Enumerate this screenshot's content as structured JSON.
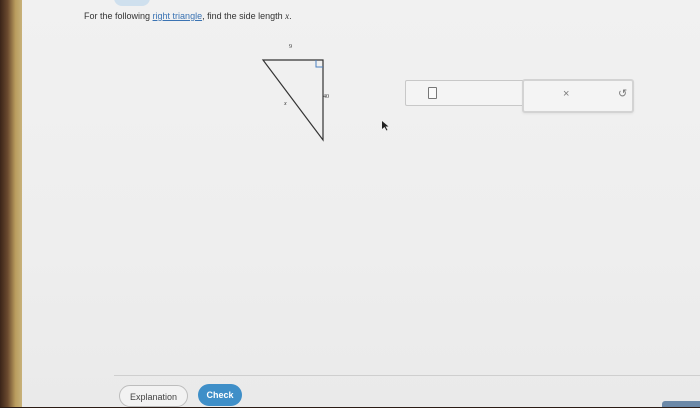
{
  "question": {
    "prefix": "For the following ",
    "link_text": "right triangle",
    "suffix": ", find the side length ",
    "variable": "x",
    "end": "."
  },
  "figure": {
    "top_label": "9",
    "right_label": "40",
    "hyp_label": "x"
  },
  "answer": {
    "value": ""
  },
  "actions": {
    "clear_symbol": "×",
    "undo_symbol": "↺"
  },
  "buttons": {
    "explanation": "Explanation",
    "check": "Check"
  },
  "colors": {
    "link": "#3a73b3",
    "check_button": "#3f8fc8"
  }
}
